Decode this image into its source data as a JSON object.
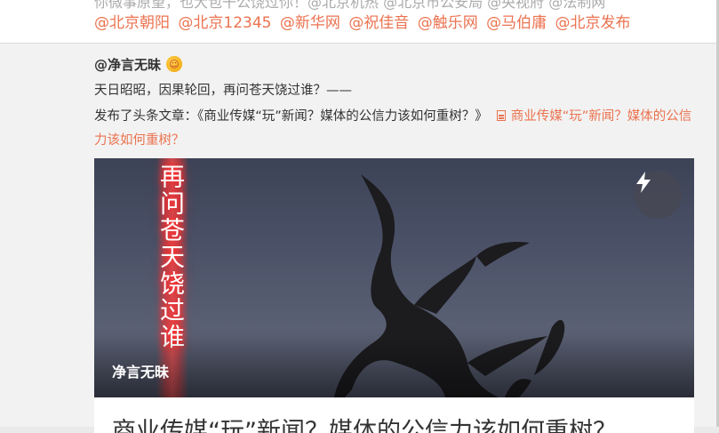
{
  "top_card": {
    "clipped_line": "你微事原望，也大包干公饶过你！@北京机热 @北京市公安局 @央视府 @法制网",
    "mentions": [
      "@北京朝阳",
      "@北京12345",
      "@新华网",
      "@祝佳音",
      "@触乐网",
      "@马伯庸",
      "@北京发布"
    ]
  },
  "post": {
    "author": "@净言无昧",
    "badge_icon": "emoji-badge-icon",
    "line1": "天日昭昭，因果轮回，再问苍天饶过谁？——",
    "line2_prefix": "发布了头条文章：《商业传媒“玩”新闻？媒体的公信力该如何重树？》",
    "article_link": "商业传媒“玩”新闻？媒体的公信力该如何重树？",
    "link_icon": "document-icon",
    "cover": {
      "vertical_title": "再问苍天饶过谁",
      "author": "净言无昧",
      "flash_icon": "lightning-icon"
    },
    "article_title": "商业传媒“玩”新闻？媒体的公信力该如何重树？"
  },
  "colors": {
    "link": "#eb7350",
    "text": "#333333",
    "background": "#f2f2f2"
  }
}
